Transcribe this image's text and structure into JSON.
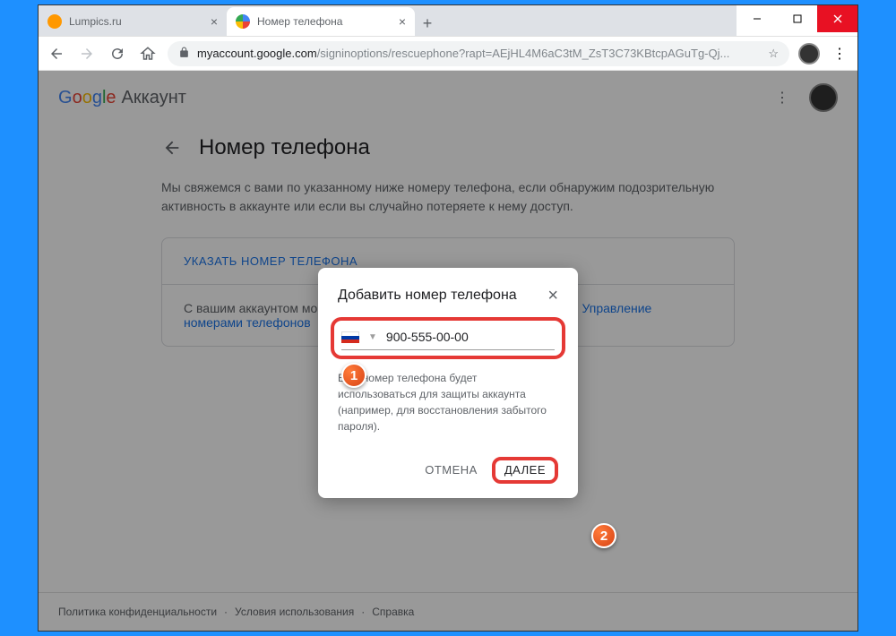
{
  "tabs": [
    {
      "title": "Lumpics.ru",
      "favicon_color": "#ff9800"
    },
    {
      "title": "Номер телефона",
      "active": true
    }
  ],
  "window_controls": {
    "minimize": "—",
    "maximize": "▢",
    "close": "✕"
  },
  "addressbar": {
    "domain": "myaccount.google.com",
    "path": "/signinoptions/rescuephone?rapt=AEjHL4M6aC3tM_ZsT3C73KBtcpAGuTg-Qj..."
  },
  "header": {
    "brand_account": "Аккаунт"
  },
  "page": {
    "title": "Номер телефона",
    "description": "Мы свяжемся с вами по указанному ниже номеру телефона, если обнаружим подозрительную активность в аккаунте или если вы случайно потеряете к нему доступ.",
    "set_number_label": "УКАЗАТЬ НОМЕР ТЕЛЕФОНА",
    "linked_text": "С вашим аккаунтом могут быть связаны другие номера телефонов. ",
    "linked_link": "Управление номерами телефонов"
  },
  "dialog": {
    "title": "Добавить номер телефона",
    "phone_value": "900-555-00-00",
    "description": "Ваш номер телефона будет использоваться для защиты аккаунта (например, для восстановления забытого пароля).",
    "cancel": "ОТМЕНА",
    "next": "ДАЛЕЕ"
  },
  "footer": {
    "privacy": "Политика конфиденциальности",
    "terms": "Условия использования",
    "help": "Справка",
    "separator": "·"
  },
  "badges": {
    "one": "1",
    "two": "2"
  }
}
